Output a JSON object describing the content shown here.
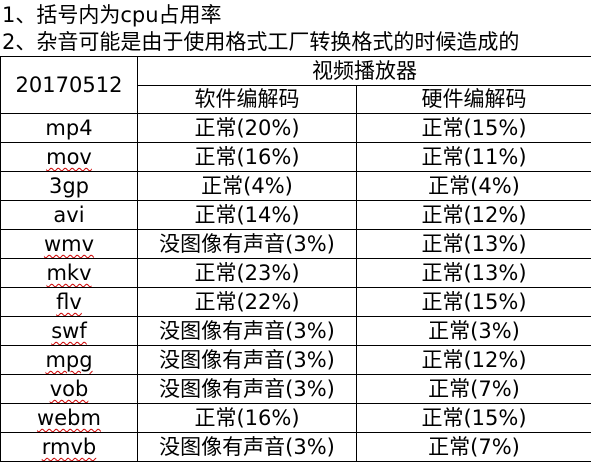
{
  "notes": [
    "1、括号内为cpu占用率",
    "2、杂音可能是由于使用格式工厂转换格式的时候造成的"
  ],
  "table": {
    "date": "20170512",
    "group_header": "视频播放器",
    "columns": [
      "软件编解码",
      "硬件编解码"
    ],
    "rows": [
      {
        "format": "mp4",
        "software": "正常(20%)",
        "hardware": "正常(15%)",
        "spell_flag": false
      },
      {
        "format": "mov",
        "software": "正常(16%)",
        "hardware": "正常(11%)",
        "spell_flag": true
      },
      {
        "format": "3gp",
        "software": "正常(4%)",
        "hardware": "正常(4%)",
        "spell_flag": false
      },
      {
        "format": "avi",
        "software": "正常(14%)",
        "hardware": "正常(12%)",
        "spell_flag": false
      },
      {
        "format": "wmv",
        "software": "没图像有声音(3%)",
        "hardware": "正常(13%)",
        "spell_flag": true
      },
      {
        "format": "mkv",
        "software": "正常(23%)",
        "hardware": "正常(13%)",
        "spell_flag": true
      },
      {
        "format": "flv",
        "software": "正常(22%)",
        "hardware": "正常(15%)",
        "spell_flag": true
      },
      {
        "format": "swf",
        "software": "没图像有声音(3%)",
        "hardware": "正常(3%)",
        "spell_flag": true
      },
      {
        "format": "mpg",
        "software": "没图像有声音(3%)",
        "hardware": "正常(12%)",
        "spell_flag": true
      },
      {
        "format": "vob",
        "software": "没图像有声音(3%)",
        "hardware": "正常(7%)",
        "spell_flag": true
      },
      {
        "format": "webm",
        "software": "正常(16%)",
        "hardware": "正常(15%)",
        "spell_flag": true
      },
      {
        "format": "rmvb",
        "software": "没图像有声音(3%)",
        "hardware": "正常(7%)",
        "spell_flag": true
      }
    ]
  },
  "colors": {
    "text": "#000000",
    "border": "#000000",
    "background": "#ffffff",
    "spellcheck_underline": "#cc0000"
  }
}
